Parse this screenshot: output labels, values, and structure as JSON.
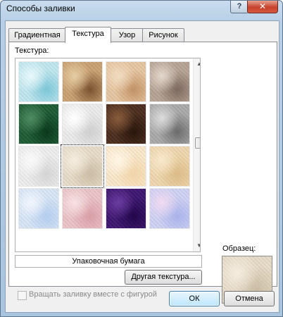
{
  "window": {
    "title": "Способы заливки",
    "help_glyph": "?",
    "close_glyph": "✕"
  },
  "tabs": [
    {
      "label": "Градиентная",
      "active": false
    },
    {
      "label": "Текстура",
      "active": true
    },
    {
      "label": "Узор",
      "active": false
    },
    {
      "label": "Рисунок",
      "active": false
    }
  ],
  "texture_panel": {
    "label": "Текстура:",
    "selected_index": 9,
    "selected_name": "Упаковочная бумага",
    "other_texture_label": "Другая текстура...",
    "textures": [
      {
        "icon": "water-droplets-texture",
        "colors": [
          "#bfe7ef",
          "#7cc6d7",
          "#e8f8fb"
        ]
      },
      {
        "icon": "brown-paper-bag-texture",
        "colors": [
          "#c9a071",
          "#7a5230",
          "#e7cda4"
        ]
      },
      {
        "icon": "fish-fossil-texture",
        "colors": [
          "#e7c6a0",
          "#c29266",
          "#f1dcc0"
        ]
      },
      {
        "icon": "granite-texture",
        "colors": [
          "#b6a394",
          "#7d6a5e",
          "#e3d7cc"
        ]
      },
      {
        "icon": "green-marble-texture",
        "colors": [
          "#1c5a33",
          "#0b3a1c",
          "#4f8c62"
        ]
      },
      {
        "icon": "white-marble-texture",
        "colors": [
          "#ececec",
          "#cfcfcf",
          "#ffffff"
        ]
      },
      {
        "icon": "brown-marble-texture",
        "colors": [
          "#4a2c1c",
          "#2a170c",
          "#8a5c3c"
        ]
      },
      {
        "icon": "gray-granite-texture",
        "colors": [
          "#a9a9a9",
          "#6c6c6c",
          "#dcdcdc"
        ]
      },
      {
        "icon": "newsprint-texture",
        "colors": [
          "#eeeeee",
          "#d4d4d4",
          "#fafafa"
        ]
      },
      {
        "icon": "recycled-paper-texture",
        "colors": [
          "#e8dcc8",
          "#cbbda4",
          "#f4ecde"
        ]
      },
      {
        "icon": "parchment-texture",
        "colors": [
          "#fbe9cb",
          "#f1d4a8",
          "#fff6e6"
        ]
      },
      {
        "icon": "stationery-texture",
        "colors": [
          "#efd7ad",
          "#dcbb86",
          "#f8e8cc"
        ]
      },
      {
        "icon": "blue-tissue-paper-texture",
        "colors": [
          "#d8e6f7",
          "#b4cdef",
          "#f1f6fd"
        ]
      },
      {
        "icon": "pink-tissue-paper-texture",
        "colors": [
          "#ecc3c7",
          "#d99ea6",
          "#f7e1e3"
        ]
      },
      {
        "icon": "purple-mesh-texture",
        "colors": [
          "#3d1470",
          "#22074a",
          "#6a3da0"
        ]
      },
      {
        "icon": "bouquet-texture",
        "colors": [
          "#cfd2f4",
          "#a9b2ea",
          "#f1d9f1"
        ]
      }
    ]
  },
  "sample": {
    "label": "Образец:",
    "colors": [
      "#e8dcc8",
      "#cbbda4",
      "#f4ecde"
    ]
  },
  "rotate_with_shape": {
    "label": "Вращать заливку вместе с фигурой",
    "checked": false,
    "enabled": false
  },
  "buttons": {
    "ok": "ОК",
    "cancel": "Отмена"
  }
}
